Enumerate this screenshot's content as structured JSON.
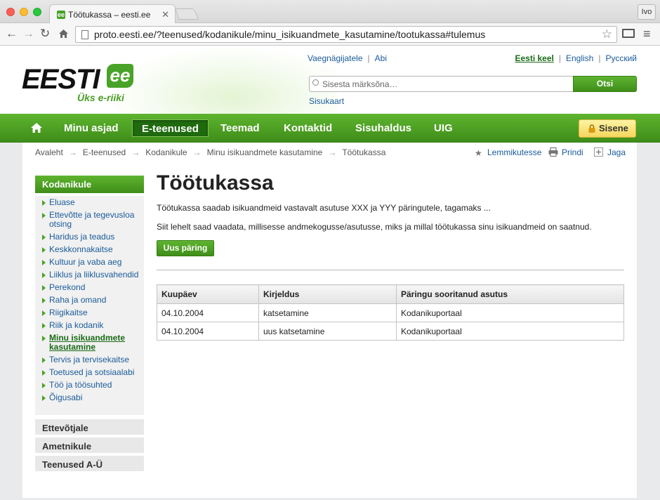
{
  "browser": {
    "tab_title": "Töötukassa – eesti.ee",
    "tab_favicon": "ee",
    "user_label": "Ivo",
    "url": "proto.eesti.ee/?teenused/kodanikule/minu_isikuandmete_kasutamine/tootukassa#tulemus"
  },
  "header": {
    "logo_text": "EESTI",
    "logo_badge": "ee",
    "logo_tagline": "Üks e-riiki",
    "top_links": [
      "Vaegnägijatele",
      "Abi"
    ],
    "languages": [
      "Eesti keel",
      "English",
      "Русский"
    ],
    "search_placeholder": "Sisesta märksõna…",
    "search_button": "Otsi",
    "sitemap": "Sisukaart"
  },
  "nav": {
    "items": [
      "Minu asjad",
      "E-teenused",
      "Teemad",
      "Kontaktid",
      "Sisuhaldus",
      "UIG"
    ],
    "active": "E-teenused",
    "login": "Sisene"
  },
  "breadcrumb": [
    "Avaleht",
    "E-teenused",
    "Kodanikule",
    "Minu isikuandmete kasutamine",
    "Töötukassa"
  ],
  "tools": [
    "Lemmikutesse",
    "Prindi",
    "Jaga"
  ],
  "sidebar": {
    "heading": "Kodanikule",
    "items": [
      "Eluase",
      "Ettevõtte ja tegevusloa otsing",
      "Haridus ja teadus",
      "Keskkonnakaitse",
      "Kultuur ja vaba aeg",
      "Liiklus ja liiklusvahendid",
      "Perekond",
      "Raha ja omand",
      "Riigikaitse",
      "Riik ja kodanik",
      "Minu isikuandmete kasutamine",
      "Tervis ja tervisekaitse",
      "Toetused ja sotsiaalabi",
      "Töö ja töösuhted",
      "Õigusabi"
    ],
    "active": "Minu isikuandmete kasutamine",
    "sections": [
      "Ettevõtjale",
      "Ametnikule",
      "Teenused A-Ü"
    ]
  },
  "main": {
    "title": "Töötukassa",
    "intro": "Töötukassa saadab isikuandmeid vastavalt asutuse XXX ja YYY päringutele, tagamaks ...",
    "description": "Siit lehelt saad vaadata, millisesse andmekogusse/asutusse, miks ja millal töötukassa sinu isikuandmeid on saatnud.",
    "new_query_button": "Uus päring",
    "table": {
      "headers": [
        "Kuupäev",
        "Kirjeldus",
        "Päringu sooritanud asutus"
      ],
      "rows": [
        [
          "04.10.2004",
          "katsetamine",
          "Kodanikuportaal"
        ],
        [
          "04.10.2004",
          "uus katsetamine",
          "Kodanikuportaal"
        ]
      ]
    }
  },
  "colors": {
    "brand_green": "#48a228",
    "nav_active": "#1f6a0e",
    "link": "#1a5a9a",
    "login_yellow": "#f6d65d"
  }
}
